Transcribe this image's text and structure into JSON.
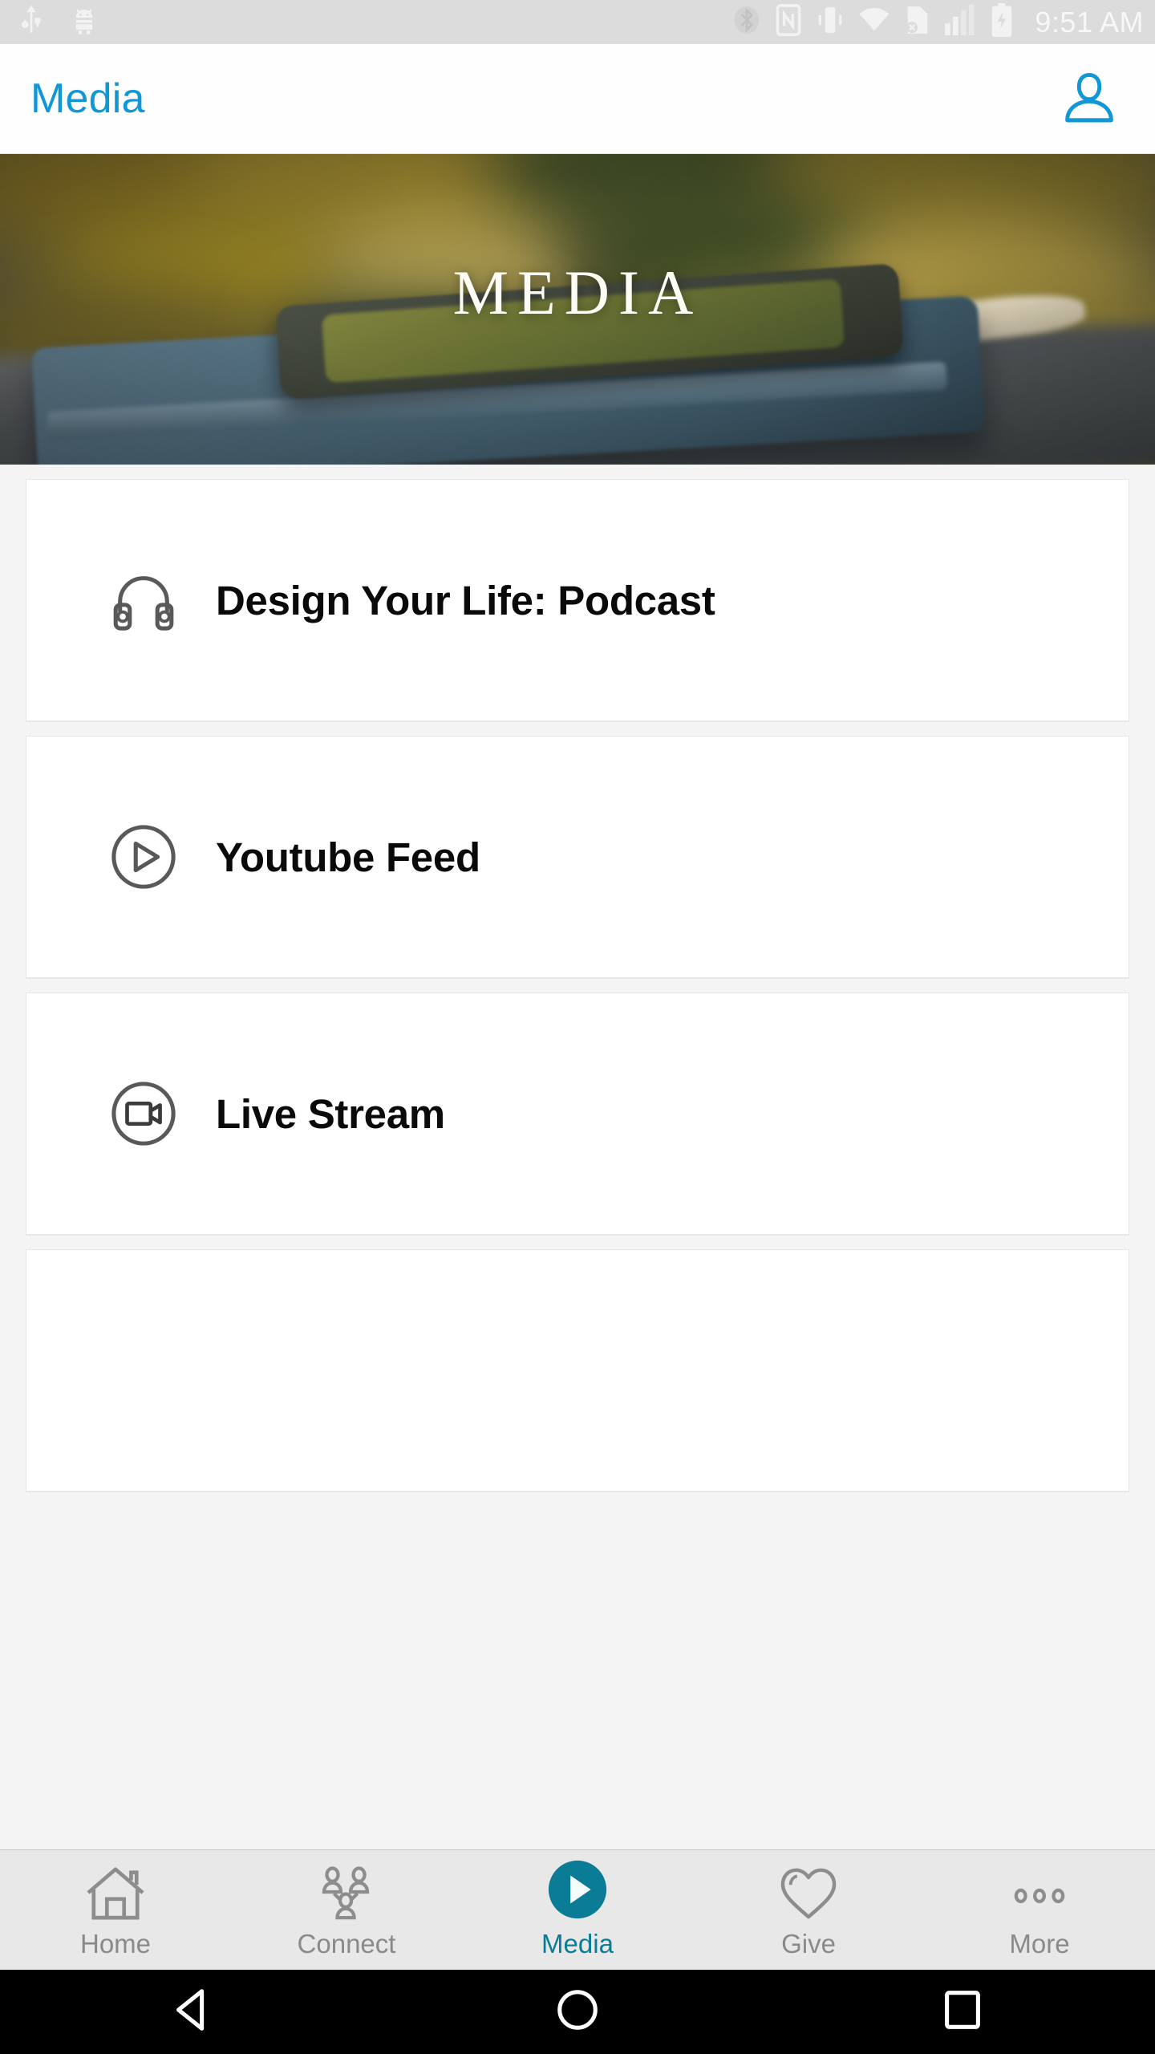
{
  "status_bar": {
    "time": "9:51 AM",
    "left_icons": [
      "usb-icon",
      "android-debug-icon"
    ],
    "right_icons": [
      "bluetooth-off-icon",
      "nfc-icon",
      "vibrate-icon",
      "wifi-icon",
      "sd-card-error-icon",
      "cellular-signal-icon",
      "battery-charging-icon"
    ],
    "background_color": "#dcdcdc",
    "foreground_color": "#f5f5f5"
  },
  "header": {
    "title": "Media",
    "title_color": "#0f97d6",
    "profile_icon": "user-profile-icon"
  },
  "hero": {
    "overlay_text": "MEDIA",
    "description": "Blurred photo of a smartphone resting on a blue notebook on a weathered wooden table with golden bokeh foliage background"
  },
  "media_list": {
    "items": [
      {
        "label": "Design Your Life: Podcast",
        "icon": "headphones-icon"
      },
      {
        "label": "Youtube Feed",
        "icon": "play-circle-icon"
      },
      {
        "label": "Live Stream",
        "icon": "video-camera-circle-icon"
      },
      {
        "label": "",
        "icon": ""
      }
    ]
  },
  "bottom_nav": {
    "active_color": "#0b7c96",
    "inactive_color": "#8a8a8a",
    "items": [
      {
        "label": "Home",
        "icon": "home-icon",
        "active": false
      },
      {
        "label": "Connect",
        "icon": "people-icon",
        "active": false
      },
      {
        "label": "Media",
        "icon": "play-circle-filled-icon",
        "active": true
      },
      {
        "label": "Give",
        "icon": "heart-icon",
        "active": false
      },
      {
        "label": "More",
        "icon": "ellipsis-icon",
        "active": false
      }
    ]
  },
  "system_nav": {
    "buttons": [
      {
        "name": "back-button",
        "icon": "triangle-left-icon"
      },
      {
        "name": "home-button",
        "icon": "circle-icon"
      },
      {
        "name": "recents-button",
        "icon": "square-icon"
      }
    ]
  }
}
